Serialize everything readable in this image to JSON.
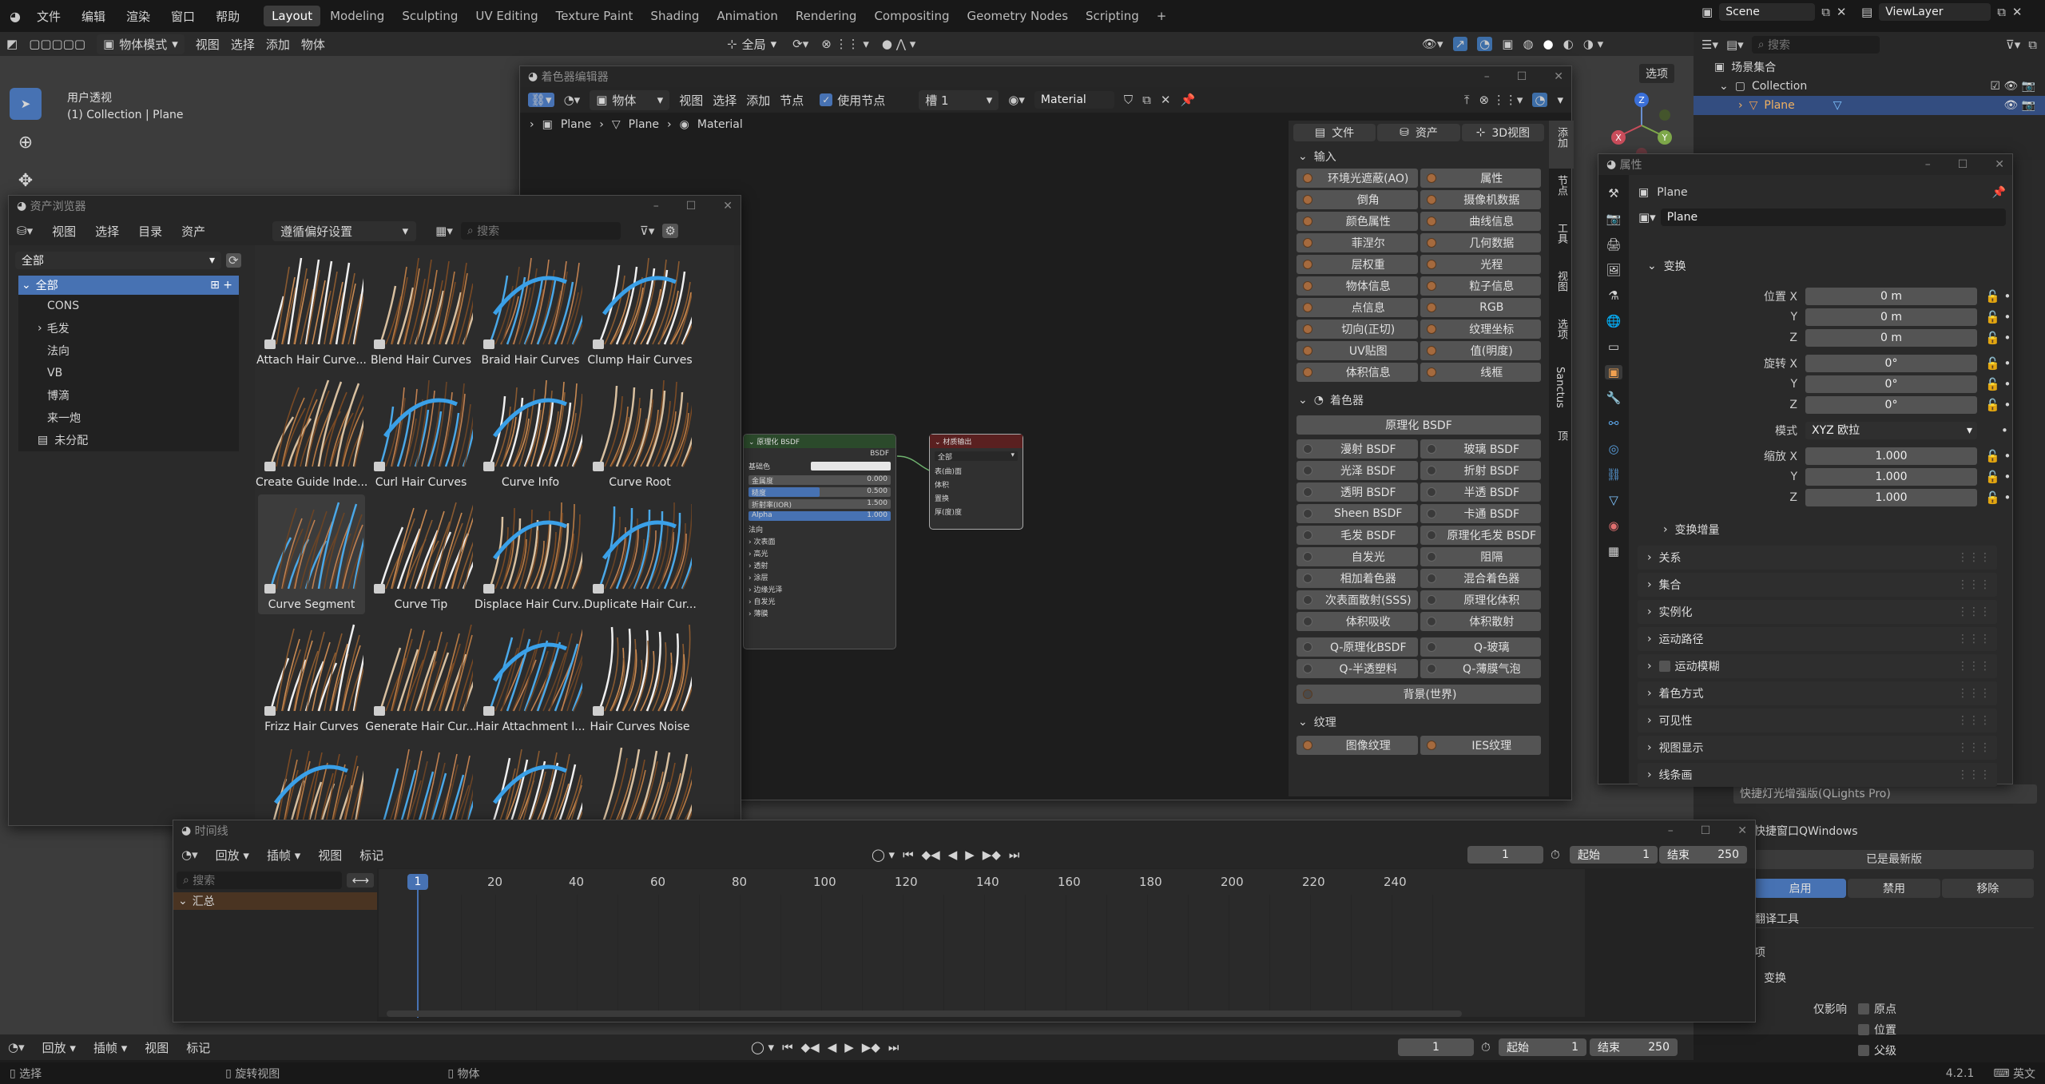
{
  "topbar": {
    "menus": [
      "文件",
      "编辑",
      "渲染",
      "窗口",
      "帮助"
    ],
    "workspaces": [
      "Layout",
      "Modeling",
      "Sculpting",
      "UV Editing",
      "Texture Paint",
      "Shading",
      "Animation",
      "Rendering",
      "Compositing",
      "Geometry Nodes",
      "Scripting"
    ],
    "active_workspace": "Layout",
    "scene": "Scene",
    "view_layer": "ViewLayer"
  },
  "viewport": {
    "mode": "物体模式",
    "menus": [
      "视图",
      "选择",
      "添加",
      "物体"
    ],
    "transform": "全局",
    "view_name": "用户透视",
    "collection_path": "(1) Collection | Plane",
    "options": "选项"
  },
  "outliner": {
    "search_placeholder": "搜索",
    "root": "场景集合",
    "collection": "Collection",
    "plane": "Plane"
  },
  "shader_editor": {
    "title": "着色器编辑器",
    "object_dropdown": "物体",
    "menus": [
      "视图",
      "选择",
      "添加",
      "节点"
    ],
    "use_nodes": "使用节点",
    "slot": "槽 1",
    "material": "Material",
    "breadcrumb": [
      "Plane",
      "Plane",
      "Material"
    ],
    "node_bsdf": {
      "title": "原理化 BSDF",
      "out": "BSDF",
      "base_color": "基础色",
      "metallic": "金属度",
      "metallic_val": "0.000",
      "roughness": "糙度",
      "roughness_val": "0.500",
      "roughness_level": 0.5,
      "ior": "折射率(IOR)",
      "ior_val": "1.500",
      "alpha": "Alpha",
      "alpha_val": "1.000",
      "normal": "法向",
      "subs": [
        "次表面",
        "高光",
        "透射",
        "涂层",
        "边缘光泽",
        "自发光",
        "薄膜"
      ]
    },
    "node_output": {
      "title": "材质输出",
      "target": "全部",
      "sockets": [
        "表(曲)面",
        "体积",
        "置换",
        "厚(度)度"
      ]
    }
  },
  "add_panel": {
    "tabs": [
      "文件",
      "资产",
      "3D视图"
    ],
    "input_header": "输入",
    "inputs": [
      [
        "环境光遮蔽(AO)",
        "属性"
      ],
      [
        "倒角",
        "摄像机数据"
      ],
      [
        "颜色属性",
        "曲线信息"
      ],
      [
        "菲涅尔",
        "几何数据"
      ],
      [
        "层权重",
        "光程"
      ],
      [
        "物体信息",
        "粒子信息"
      ],
      [
        "点信息",
        "RGB"
      ],
      [
        "切向(正切)",
        "纹理坐标"
      ],
      [
        "UV贴图",
        "值(明度)"
      ],
      [
        "体积信息",
        "线框"
      ]
    ],
    "shader_header": "着色器",
    "principled": "原理化 BSDF",
    "shaders": [
      [
        "漫射 BSDF",
        "玻璃 BSDF"
      ],
      [
        "光泽 BSDF",
        "折射 BSDF"
      ],
      [
        "透明 BSDF",
        "半透 BSDF"
      ],
      [
        "Sheen BSDF",
        "卡通 BSDF"
      ],
      [
        "毛发 BSDF",
        "原理化毛发 BSDF"
      ],
      [
        "自发光",
        "阻隔"
      ],
      [
        "相加着色器",
        "混合着色器"
      ],
      [
        "次表面散射(SSS)",
        "原理化体积"
      ],
      [
        "体积吸收",
        "体积散射"
      ]
    ],
    "q": [
      [
        "Q-原理化BSDF",
        "Q-玻璃"
      ],
      [
        "Q-半透塑料",
        "Q-薄膜气泡"
      ]
    ],
    "bg": "背景(世界)",
    "texture_header": "纹理",
    "texture_cut": [
      "图像纹理",
      "IES纹理"
    ],
    "side_tabs": [
      "添加",
      "节点",
      "工具",
      "视图",
      "选项",
      "Sanctus",
      "顶"
    ]
  },
  "asset_browser": {
    "title": "资产浏览器",
    "menus": [
      "视图",
      "选择",
      "目录",
      "资产"
    ],
    "pref": "遵循偏好设置",
    "search_placeholder": "搜索",
    "filter": "全部",
    "tree": [
      {
        "label": "全部",
        "expanded": true
      },
      {
        "label": "CONS"
      },
      {
        "label": "毛发",
        "collapsed": true
      },
      {
        "label": "法向"
      },
      {
        "label": "VB"
      },
      {
        "label": "博滴"
      },
      {
        "label": "来一炮"
      },
      {
        "label": "未分配"
      }
    ],
    "assets": [
      "Attach Hair Curve...",
      "Blend Hair Curves",
      "Braid Hair Curves",
      "Clump Hair Curves",
      "Create Guide Inde...",
      "Curl Hair Curves",
      "Curve Info",
      "Curve Root",
      "Curve Segment",
      "Curve Tip",
      "Displace Hair Curv...",
      "Duplicate Hair Cur...",
      "Frizz Hair Curves",
      "Generate Hair Cur...",
      "Hair Attachment I...",
      "Hair Curves Noise",
      "",
      "",
      "",
      ""
    ]
  },
  "properties": {
    "title": "属性",
    "object": "Plane",
    "data_name": "Plane",
    "transform": "变换",
    "loc": [
      "位置 X",
      "Y",
      "Z"
    ],
    "loc_vals": [
      "0 m",
      "0 m",
      "0 m"
    ],
    "rot": [
      "旋转 X",
      "Y",
      "Z"
    ],
    "rot_vals": [
      "0°",
      "0°",
      "0°"
    ],
    "mode_label": "模式",
    "mode": "XYZ 欧拉",
    "scale": [
      "缩放 X",
      "Y",
      "Z"
    ],
    "scale_vals": [
      "1.000",
      "1.000",
      "1.000"
    ],
    "delta": "变换增量",
    "panels": [
      "关系",
      "集合",
      "实例化",
      "运动路径",
      "运动模糊",
      "着色方式",
      "可见性",
      "视图显示",
      "线条画"
    ]
  },
  "addon": {
    "item": "快捷灯光增强版(QLights Pro)",
    "qwin": "快捷窗口QWindows",
    "latest": "已是最新版",
    "enable": "启用",
    "disable": "禁用",
    "remove": "移除",
    "translate": "翻译工具",
    "opt": "项",
    "transform": "变换",
    "affect": "仅影响",
    "origin": "原点",
    "location": "位置",
    "parent": "父级"
  },
  "timeline": {
    "title": "时间线",
    "menus": [
      "回放",
      "插帧",
      "视图",
      "标记"
    ],
    "search_placeholder": "搜索",
    "summary": "汇总",
    "current": "1",
    "start_label": "起始",
    "start": "1",
    "end_label": "结束",
    "end": "250",
    "ticks": [
      "1",
      "20",
      "40",
      "60",
      "80",
      "100",
      "120",
      "140",
      "160",
      "180",
      "200",
      "220",
      "240"
    ]
  },
  "bottom_timeline": {
    "menus": [
      "回放",
      "插帧",
      "视图",
      "标记"
    ],
    "current": "1",
    "start_label": "起始",
    "start": "1",
    "end_label": "结束",
    "end": "250"
  },
  "statusbar": {
    "select": "选择",
    "rotate": "旋转视图",
    "object": "物体",
    "version": "4.2.1",
    "ime": "英文"
  }
}
